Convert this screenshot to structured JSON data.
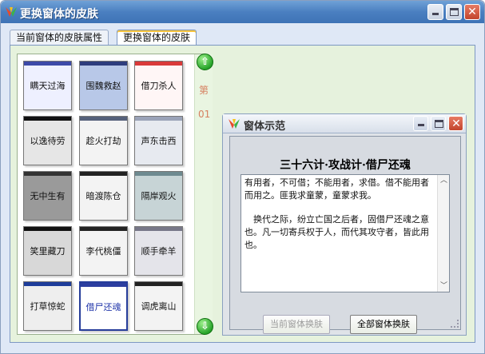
{
  "window": {
    "title": "更换窗体的皮肤"
  },
  "tabs": [
    {
      "label": "当前窗体的皮肤属性",
      "active": false
    },
    {
      "label": "更换窗体的皮肤",
      "active": true
    }
  ],
  "skins": [
    {
      "label": "瞒天过海",
      "bg": "#eef0ff",
      "bar": "#3d4aa8"
    },
    {
      "label": "围魏救赵",
      "bg": "#b8c8e8",
      "bar": "#2e3d7d"
    },
    {
      "label": "借刀杀人",
      "bg": "#fff6f6",
      "bar": "#d93a3a"
    },
    {
      "label": "以逸待劳",
      "bg": "#e6e6e6",
      "bar": "#111111"
    },
    {
      "label": "趁火打劫",
      "bg": "#f3f3f3",
      "bar": "#55607a"
    },
    {
      "label": "声东击西",
      "bg": "#e7eaf0",
      "bar": "#9aa3b8"
    },
    {
      "label": "无中生有",
      "bg": "#9a9a9a",
      "bar": "#333333"
    },
    {
      "label": "暗渡陈仓",
      "bg": "#f3f3f3",
      "bar": "#222222"
    },
    {
      "label": "隔岸观火",
      "bg": "#c7d4d6",
      "bar": "#6e8a90"
    },
    {
      "label": "笑里藏刀",
      "bg": "#d8d8d8",
      "bar": "#111111"
    },
    {
      "label": "李代桃僵",
      "bg": "#f3f3f3",
      "bar": "#222222"
    },
    {
      "label": "顺手牵羊",
      "bg": "#e4e4ea",
      "bar": "#777788"
    },
    {
      "label": "打草惊蛇",
      "bg": "#eeeeee",
      "bar": "#1e3d9a"
    },
    {
      "label": "借尸还魂",
      "bg": "#ffffff",
      "bar": "#2c3ea0"
    },
    {
      "label": "调虎离山",
      "bg": "#f3f3f3",
      "bar": "#222222"
    }
  ],
  "selected_skin": "借尸还魂",
  "page_indicator": {
    "prefix": "第",
    "number": "01"
  },
  "icons": {
    "scroll_up": "up-arrow-icon",
    "scroll_down": "down-arrow-icon"
  },
  "demo": {
    "title": "窗体示范",
    "heading": "三十六计·攻战计·借尸还魂",
    "paragraphs": [
      "有用者，不可借；不能用者，求借。借不能用者而用之。匪我求童蒙，童蒙求我。",
      "　换代之际，纷立亡国之后者，固借尸还魂之意也。凡一切寄兵权于人，而代其攻守者，皆此用也。"
    ]
  },
  "buttons": {
    "apply_current": "当前窗体换肤",
    "apply_all": "全部窗体换肤"
  },
  "colors": {
    "accent": "#3e73b6",
    "panel": "#e6f2dd",
    "selected": "#263d9a"
  }
}
